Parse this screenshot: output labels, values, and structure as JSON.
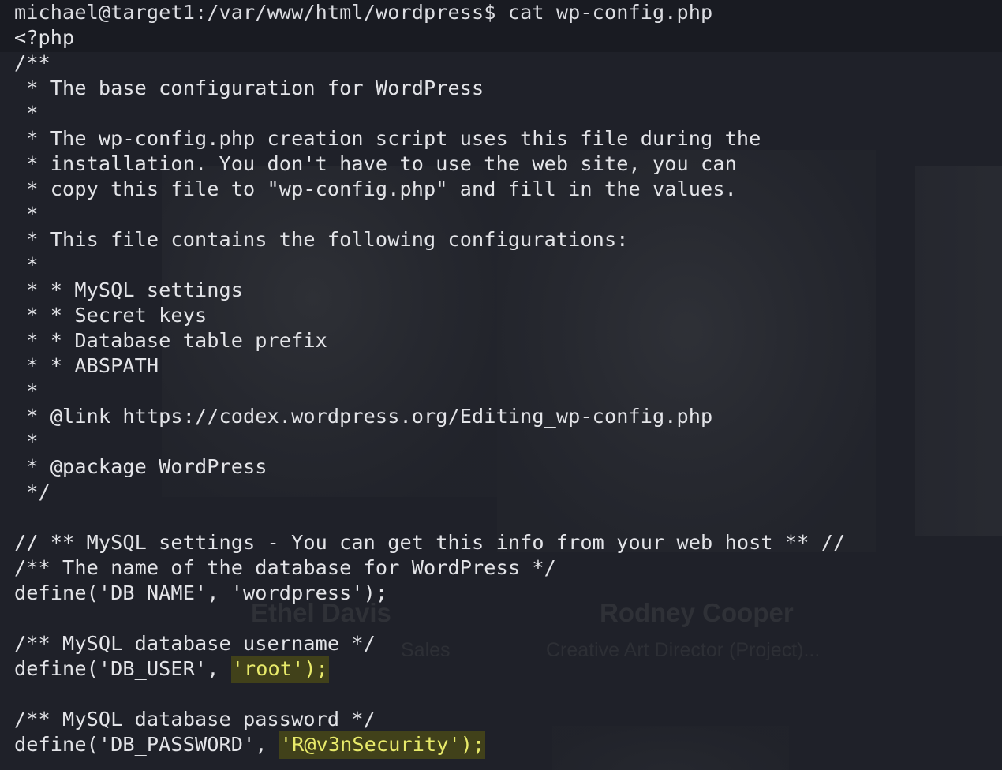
{
  "terminal": {
    "prompt": "michael@target1:/var/www/html/wordpress$ cat wp-config.php",
    "lines": [
      "<?php",
      "/**",
      " * The base configuration for WordPress",
      " *",
      " * The wp-config.php creation script uses this file during the",
      " * installation. You don't have to use the web site, you can",
      " * copy this file to \"wp-config.php\" and fill in the values.",
      " *",
      " * This file contains the following configurations:",
      " *",
      " * * MySQL settings",
      " * * Secret keys",
      " * * Database table prefix",
      " * * ABSPATH",
      " *",
      " * @link https://codex.wordpress.org/Editing_wp-config.php",
      " *",
      " * @package WordPress",
      " */",
      "",
      "// ** MySQL settings - You can get this info from your web host ** //",
      "/** The name of the database for WordPress */",
      "define('DB_NAME', 'wordpress');",
      "",
      "/** MySQL database username */"
    ],
    "db_user": {
      "prefix": "define('DB_USER', ",
      "value": "'root');"
    },
    "blank_line": "",
    "password_comment": "/** MySQL database password */",
    "db_password": {
      "prefix": "define('DB_PASSWORD', ",
      "value": "'R@v3nSecurity');"
    }
  },
  "background_page": {
    "names": [
      "Ethel Davis",
      "Rodney Cooper"
    ],
    "roles": [
      "Sales",
      "Creative Art Director (Project)..."
    ]
  },
  "colors": {
    "terminal_bg": "#1f2129",
    "text": "#e3e4e8",
    "highlight_bg": "#41411a",
    "highlight_text": "#e8ea6a"
  }
}
